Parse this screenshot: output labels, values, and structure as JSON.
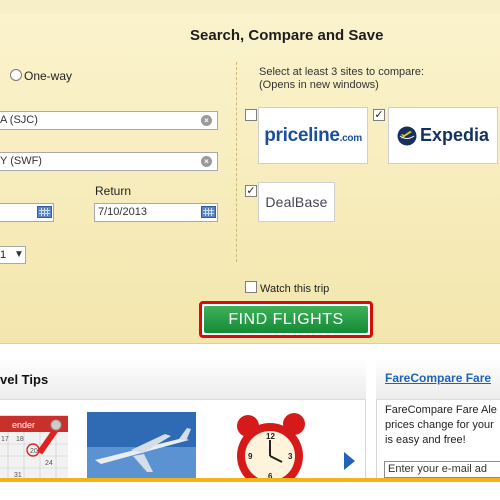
{
  "search": {
    "title": "Search, Compare and Save",
    "oneway_label": "One-way",
    "from_value": "A (SJC)",
    "to_value": "Y (SWF)",
    "return_label": "Return",
    "depart_value": "",
    "return_value": "7/10/2013",
    "passengers_value": "1",
    "compare_instructions_line1": "Select at least 3 sites to compare:",
    "compare_instructions_line2": "(Opens in new windows)",
    "sites": [
      {
        "name": "priceline",
        "suffix": ".com",
        "checked": false
      },
      {
        "name": "Expedia",
        "checked": true
      },
      {
        "name": "DealBase",
        "checked": true
      }
    ],
    "watch_label": "Watch this trip",
    "find_button": "FIND FLIGHTS"
  },
  "tips": {
    "title": "vel Tips"
  },
  "fare": {
    "title": "FareCompare Fare",
    "desc_line1": "FareCompare Fare Ale",
    "desc_line2": "prices change for your",
    "desc_line3": "is easy and free!",
    "email_placeholder": "Enter your e-mail ad"
  },
  "colors": {
    "panel_bg": "#f6ecbe",
    "find_button_green": "#1f9a43",
    "highlight_red": "#d50d0d",
    "link_blue": "#1e63b8",
    "bottom_bar": "#f2b317"
  }
}
